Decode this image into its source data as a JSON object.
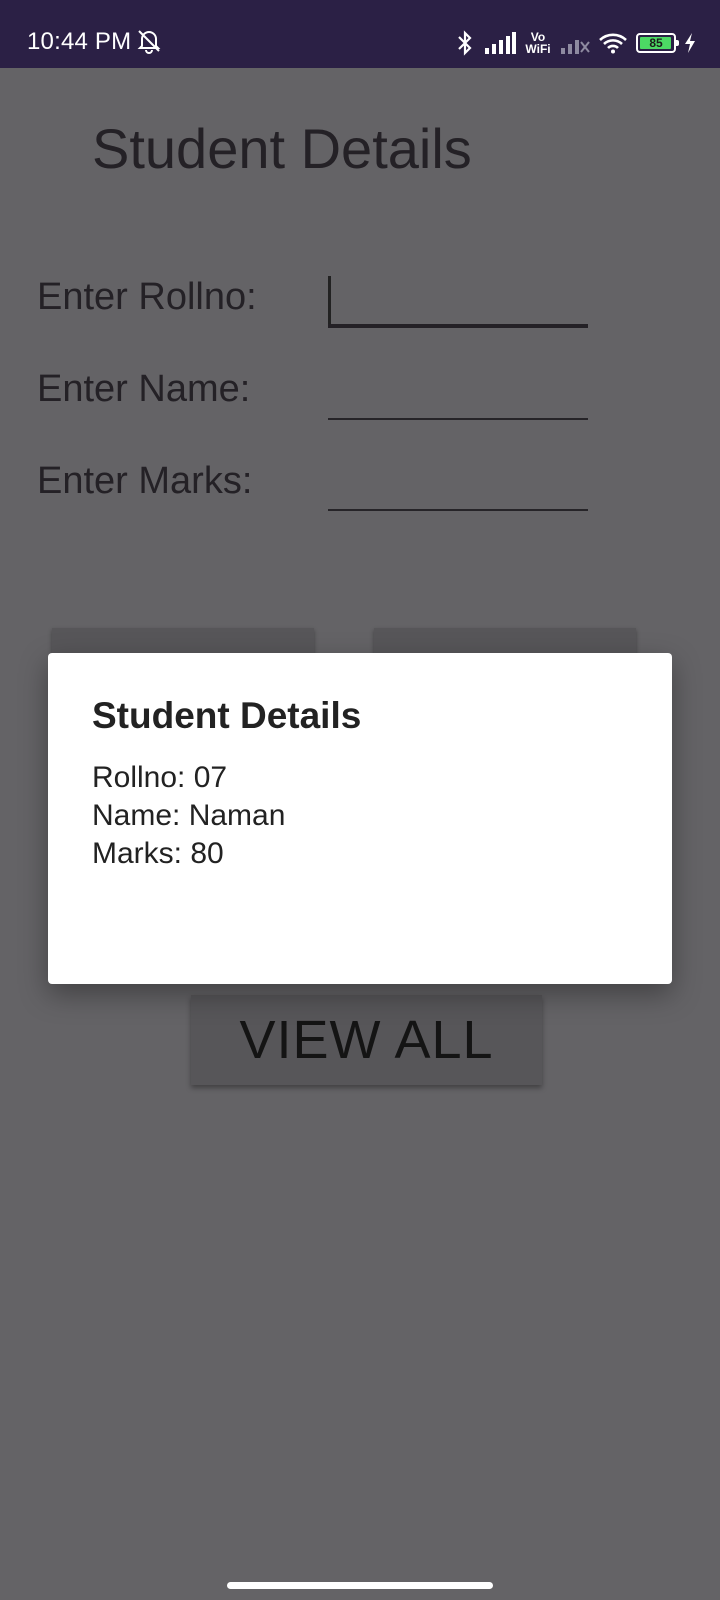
{
  "status_bar": {
    "time": "10:44 PM",
    "vowifi_top": "Vo",
    "vowifi_bottom": "WiFi",
    "battery_level": "85",
    "icons": [
      "bell-off-icon",
      "bluetooth-icon",
      "signal-icon",
      "vowifi-icon",
      "signal-no-service-icon",
      "wifi-icon",
      "battery-icon",
      "charging-icon"
    ]
  },
  "app": {
    "title": "Student Details",
    "fields": [
      {
        "label": "Enter Rollno:",
        "value": ""
      },
      {
        "label": "Enter Name:",
        "value": ""
      },
      {
        "label": "Enter Marks:",
        "value": ""
      }
    ],
    "view_all_label": "VIEW ALL"
  },
  "dialog": {
    "title": "Student Details",
    "lines": [
      "Rollno: 07",
      "Name: Naman",
      "Marks: 80"
    ]
  },
  "colors": {
    "status_bar": "#2b2045",
    "scrim_background": "#646366",
    "dialog_background": "#ffffff",
    "battery_fill": "#4cd964"
  }
}
